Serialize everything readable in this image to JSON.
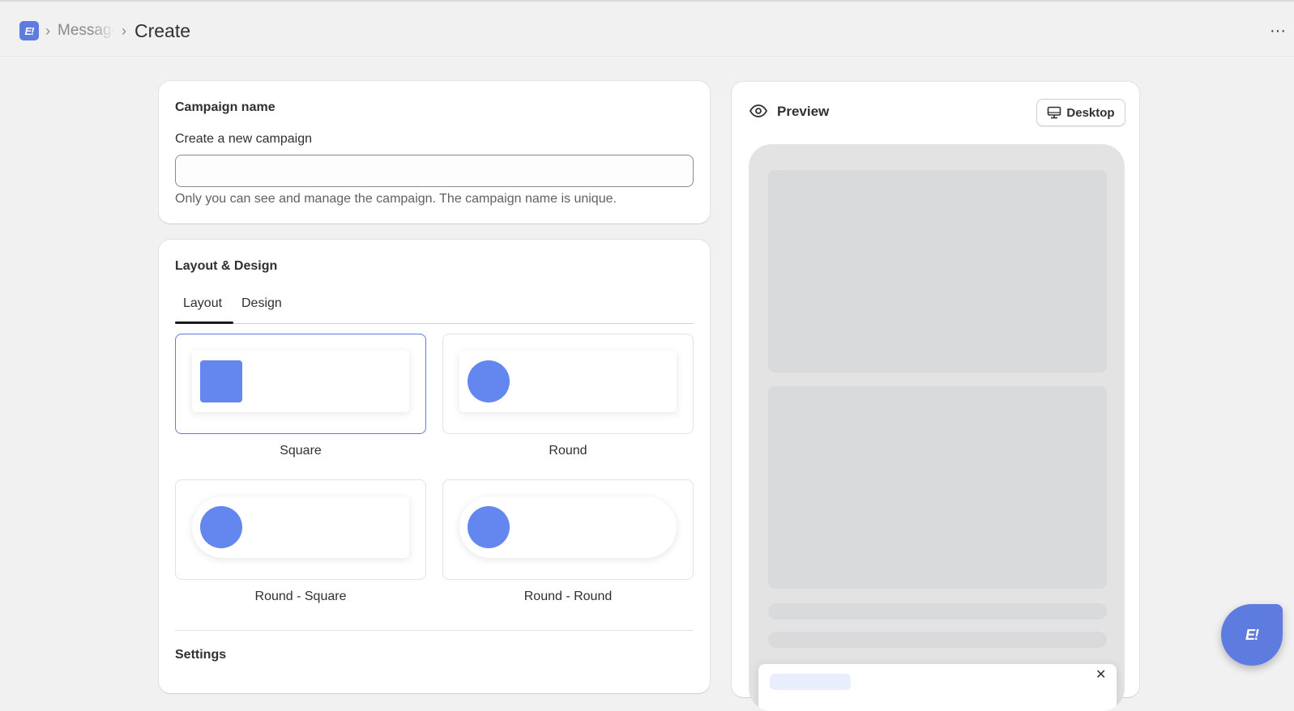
{
  "header": {
    "logo_text": "E!",
    "breadcrumb_parent": "Messages",
    "breadcrumb_sep": "›",
    "title": "Create",
    "more_label": "···"
  },
  "campaign": {
    "card_title": "Campaign name",
    "field_label": "Create a new campaign",
    "input_value": "",
    "input_placeholder": "",
    "help_text": "Only you can see and manage the campaign. The campaign name is unique."
  },
  "layout_design": {
    "card_title": "Layout & Design",
    "tabs": [
      {
        "label": "Layout",
        "active": true
      },
      {
        "label": "Design",
        "active": false
      }
    ],
    "options": [
      {
        "label": "Square",
        "selected": true
      },
      {
        "label": "Round",
        "selected": false
      },
      {
        "label": "Round - Square",
        "selected": false
      },
      {
        "label": "Round - Round",
        "selected": false
      }
    ],
    "settings_title": "Settings"
  },
  "preview": {
    "title": "Preview",
    "device_label": "Desktop",
    "popup_close": "✕"
  },
  "chat": {
    "logo_text": "E!"
  },
  "colors": {
    "accent": "#5e7ce0",
    "thumb": "#6387ee",
    "background": "#f1f1f1",
    "skeleton": "#d8dadb"
  }
}
